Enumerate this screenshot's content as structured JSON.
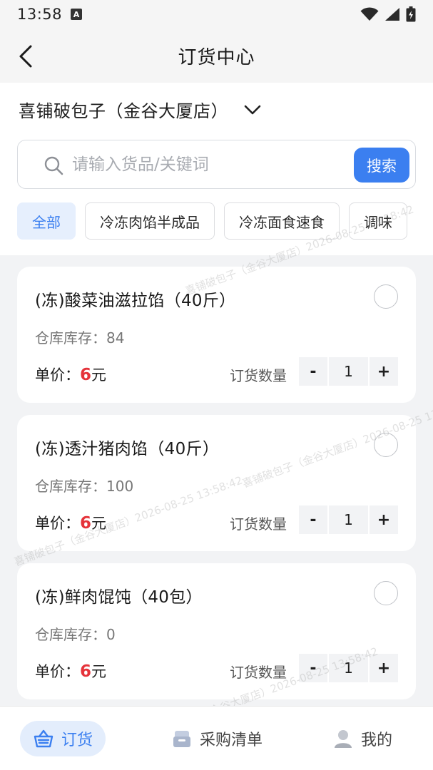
{
  "status_bar": {
    "time": "13:58",
    "notification_badge": "A"
  },
  "header": {
    "title": "订货中心"
  },
  "store": {
    "name": "喜铺破包子（金谷大厦店）"
  },
  "search": {
    "placeholder": "请输入货品/关键词",
    "button_label": "搜索"
  },
  "categories": [
    {
      "label": "全部",
      "active": true
    },
    {
      "label": "冷冻肉馅半成品",
      "active": false
    },
    {
      "label": "冷冻面食速食",
      "active": false
    },
    {
      "label": "调味",
      "active": false
    }
  ],
  "product_labels": {
    "stock_prefix": "仓库库存：",
    "price_prefix": "单价：",
    "price_unit": "元",
    "quantity_label": "订货数量",
    "minus": "-",
    "plus": "+"
  },
  "products": [
    {
      "name": "(冻)酸菜油滋拉馅（40斤）",
      "stock": "84",
      "price": "6",
      "quantity": "1"
    },
    {
      "name": "(冻)透汁猪肉馅（40斤）",
      "stock": "100",
      "price": "6",
      "quantity": "1"
    },
    {
      "name": "(冻)鲜肉馄饨（40包）",
      "stock": "0",
      "price": "6",
      "quantity": "1"
    }
  ],
  "tabs": [
    {
      "label": "订货",
      "active": true
    },
    {
      "label": "采购清单",
      "active": false
    },
    {
      "label": "我的",
      "active": false
    }
  ],
  "watermark_text": "喜铺破包子（金谷大厦店）2026-08-25 13:58:42",
  "colors": {
    "accent": "#3b7ff0",
    "price": "#e5333a",
    "background": "#f2f3f5"
  }
}
